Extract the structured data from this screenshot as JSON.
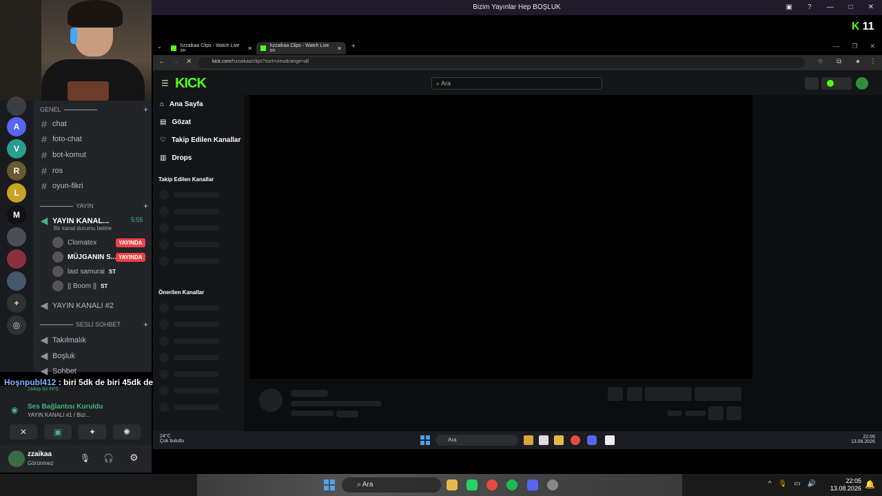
{
  "window": {
    "title": "Bizim Yayınlar Hep BOŞLUK"
  },
  "badge": {
    "count": "11"
  },
  "browser": {
    "tabs": [
      {
        "label": "hzzaikaa Clips - Watch Live on"
      },
      {
        "label": "hzzaikaa Clips - Watch Live on"
      }
    ],
    "url_host": "kick.com",
    "url_path": "/hzzaikaa/clips?sort=view&range=all"
  },
  "kick": {
    "logo": "KICK",
    "search_placeholder": "Ara",
    "nav": [
      "Ana Sayfa",
      "Gözat",
      "Takip Edilen Kanallar",
      "Drops"
    ],
    "section_followed": "Takip Edilen Kanallar",
    "section_recommended": "Önerilen Kanallar"
  },
  "discord": {
    "cat_general": "GENEL",
    "channels": [
      "chat",
      "foto-chat",
      "bot-komut",
      "ros",
      "oyun-fikri"
    ],
    "cat_stream": "YAYIN",
    "voice_active": "YAYIN KANAL...",
    "voice_time": "5:55",
    "voice_status": "Bir kanal durumu belirle",
    "users": [
      {
        "name": "Clomatex",
        "live": "YAYINDA"
      },
      {
        "name": "MÜJGANIN S...",
        "live": "YAYINDA"
      },
      {
        "name": "last samurai",
        "tag": "ST"
      },
      {
        "name": "|| Boom ||",
        "tag": "ST"
      }
    ],
    "voice2": "YAYIN KANALI #2",
    "cat_voice": "SESLİ SOHBET",
    "voice_channels": [
      "Takılmalık",
      "Boşluk",
      "Sohbet"
    ],
    "chat_user": "Hoşnpubl412",
    "chat_msg": ": biri 5dk de biri 45dk de yapıldı",
    "stream_quality": "1440p 60 FPS",
    "conn_status": "Ses Bağlantısı Kuruldu",
    "conn_sub": "YAYIN KANALI #1 / Bizi...",
    "user_name": "zzaikaa",
    "user_status": "Görünmez"
  },
  "inner_taskbar": {
    "weather_temp": "24°C",
    "weather_desc": "Çok bulutlu",
    "search": "Ara",
    "time": "22:05",
    "date": "13.08.2026"
  },
  "taskbar": {
    "search": "Ara",
    "time": "22:05",
    "date": "13.08.2026"
  },
  "colors": {
    "kick_green": "#53fc18",
    "live_red": "#ed4245",
    "discord_green": "#43b581"
  }
}
